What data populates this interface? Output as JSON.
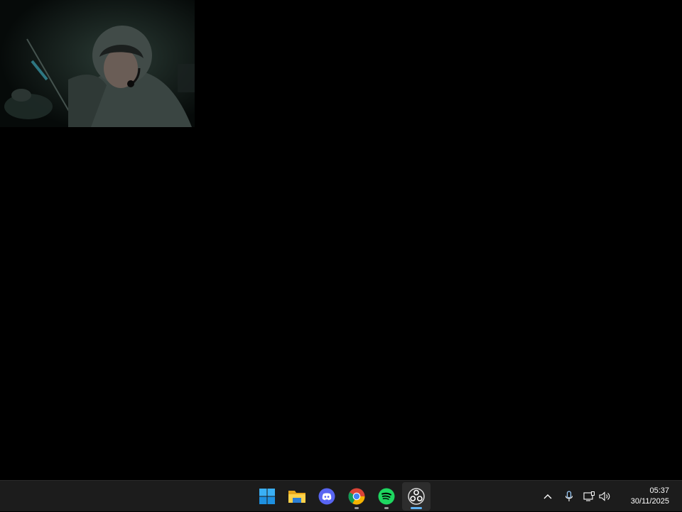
{
  "desktop": {
    "webcam_overlay": {
      "label": "webcam-feed"
    }
  },
  "taskbar": {
    "apps": [
      {
        "name": "Start",
        "icon": "windows-start-icon",
        "running": false
      },
      {
        "name": "File Explorer",
        "icon": "folder-icon",
        "running": false
      },
      {
        "name": "Discord",
        "icon": "discord-icon",
        "running": false
      },
      {
        "name": "Google Chrome",
        "icon": "chrome-icon",
        "running": true
      },
      {
        "name": "Spotify",
        "icon": "spotify-icon",
        "running": true
      },
      {
        "name": "OBS Studio",
        "icon": "obs-icon",
        "running": true,
        "active": true
      }
    ],
    "tray": {
      "icons": [
        "chevron-up-icon",
        "microphone-icon",
        "network-icon",
        "volume-icon"
      ]
    },
    "clock": {
      "time": "05:37",
      "date": "30/11/2025"
    }
  },
  "colors": {
    "taskbar_bg": "#1c1c1c",
    "active_indicator": "#5fb2f2",
    "running_indicator": "#9a9a9a",
    "windows_blue": "#2aa4f4",
    "spotify_green": "#1ed760",
    "discord_blurple": "#5865f2"
  }
}
